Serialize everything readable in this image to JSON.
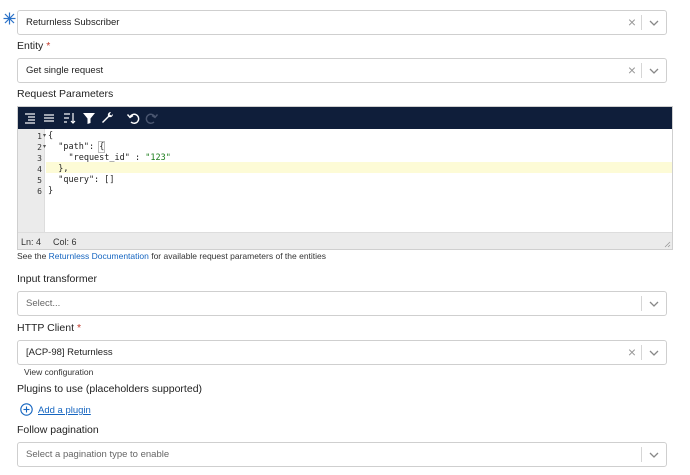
{
  "connector": {
    "icon": "returnless-logo-icon",
    "value": "Returnless Subscriber"
  },
  "entity": {
    "label": "Entity",
    "required_mark": "*",
    "value": "Get single request"
  },
  "request_parameters": {
    "label": "Request Parameters",
    "toolbar": [
      "format-icon",
      "compact-icon",
      "sort-icon",
      "filter-icon",
      "repair-icon",
      "undo-icon",
      "redo-icon"
    ],
    "gutter": [
      "1",
      "2",
      "3",
      "4",
      "5",
      "6"
    ],
    "code_lines": {
      "l1": "{",
      "l2a": "  \"path\": ",
      "l2b": "{",
      "l3a": "    \"request_id\" : ",
      "l3b": "\"123\"",
      "l4": "  },",
      "l5": "  \"query\": []",
      "l6": "}"
    },
    "status": {
      "ln": "Ln: 4",
      "col": "Col: 6"
    },
    "help_before": "See the ",
    "help_link": "Returnless Documentation",
    "help_after": " for available request parameters of the entities"
  },
  "input_transformer": {
    "label": "Input transformer",
    "placeholder": "Select..."
  },
  "http_client": {
    "label": "HTTP Client",
    "required_mark": "*",
    "value": "[ACP-98] Returnless",
    "view_config": "View configuration"
  },
  "plugins": {
    "label": "Plugins to use (placeholders supported)",
    "add_label": "Add a plugin"
  },
  "pagination": {
    "label": "Follow pagination",
    "placeholder": "Select a pagination type to enable"
  }
}
